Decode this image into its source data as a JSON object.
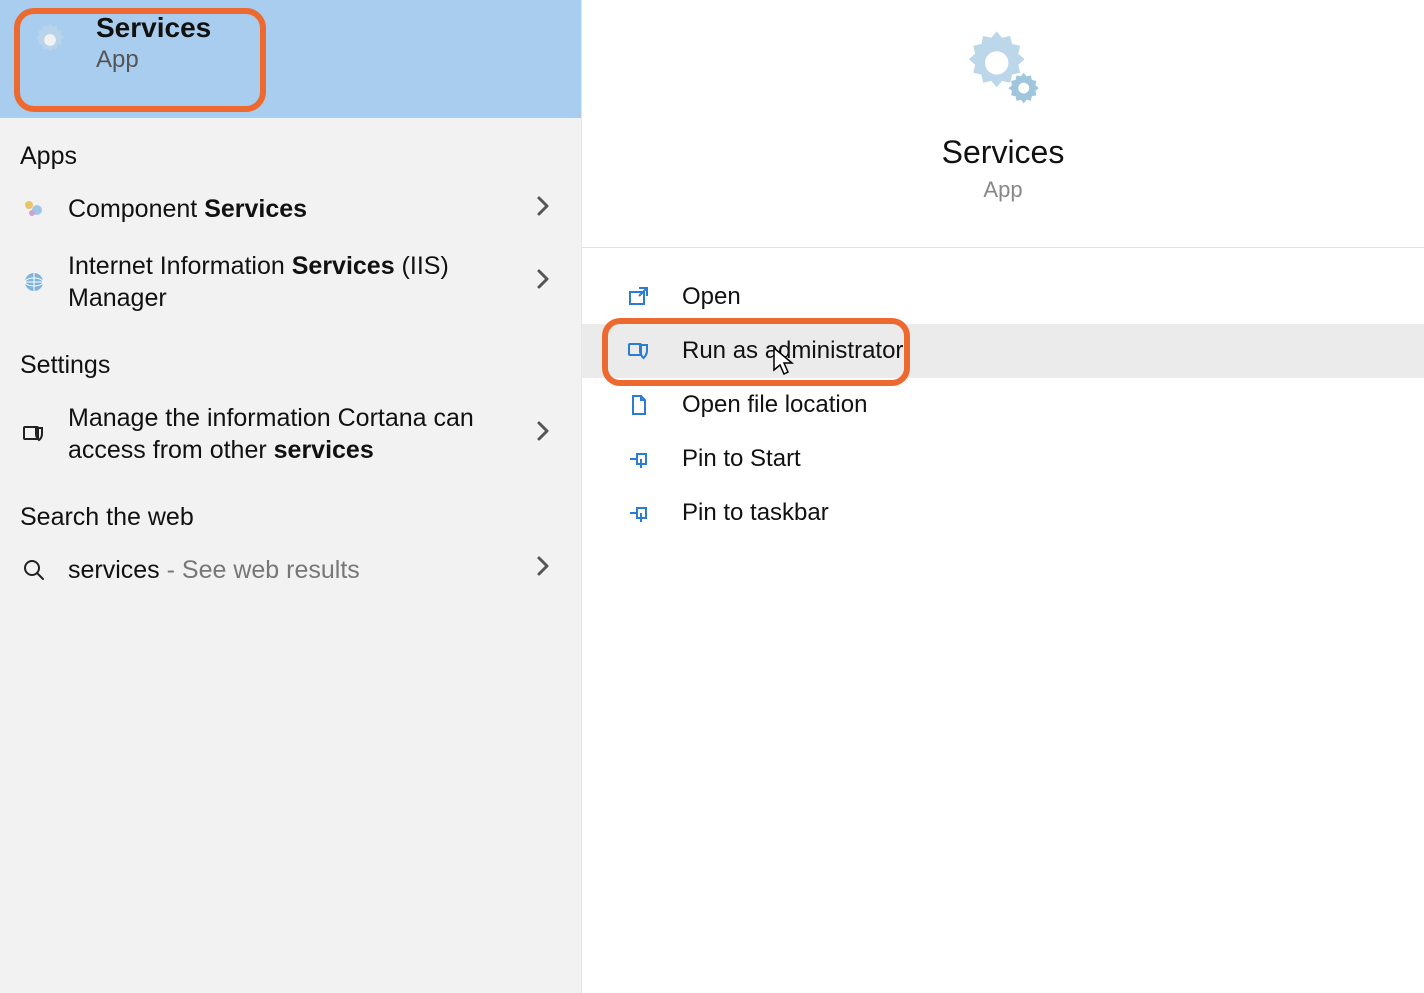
{
  "left": {
    "bestMatch": {
      "title": "Services",
      "subtitle": "App"
    },
    "sections": {
      "apps": "Apps",
      "settings": "Settings",
      "web": "Search the web"
    },
    "items": {
      "componentServices": {
        "pre": "Component ",
        "bold": "Services"
      },
      "iis": {
        "pre": "Internet Information ",
        "bold": "Services",
        "post": " (IIS) Manager"
      },
      "cortana": {
        "pre": "Manage the information Cortana can access from other ",
        "bold": "services"
      },
      "webSearch": {
        "term": "services",
        "hint": " - See web results"
      }
    }
  },
  "right": {
    "title": "Services",
    "subtitle": "App",
    "actions": {
      "open": "Open",
      "runAdmin": "Run as administrator",
      "openLoc": "Open file location",
      "pinStart": "Pin to Start",
      "pinTaskbar": "Pin to taskbar"
    }
  }
}
